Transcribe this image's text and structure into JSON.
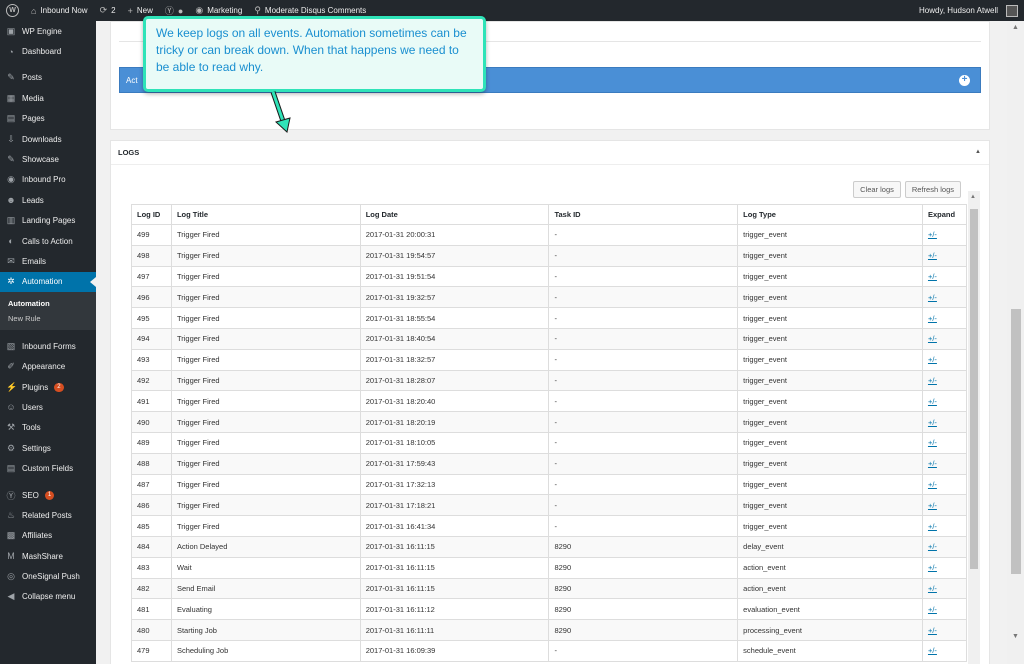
{
  "adminbar": {
    "site_name": "Inbound Now",
    "updates_count": "2",
    "new_label": "New",
    "marketing_label": "Marketing",
    "search_label": "Moderate Disqus Comments",
    "greeting": "Howdy, Hudson Atwell"
  },
  "sidebar": {
    "items": [
      {
        "label": "WP Engine",
        "icon": "wp-engine-icon",
        "glyph": "▣"
      },
      {
        "label": "Dashboard",
        "icon": "dashboard-icon",
        "glyph": "◔"
      },
      {
        "label": "Posts",
        "icon": "pin-icon",
        "glyph": "✎"
      },
      {
        "label": "Media",
        "icon": "media-icon",
        "glyph": "▦"
      },
      {
        "label": "Pages",
        "icon": "page-icon",
        "glyph": "▤"
      },
      {
        "label": "Downloads",
        "icon": "download-icon",
        "glyph": "⇩"
      },
      {
        "label": "Showcase",
        "icon": "pin-icon",
        "glyph": "✎"
      },
      {
        "label": "Inbound Pro",
        "icon": "inbound-icon",
        "glyph": "◉"
      },
      {
        "label": "Leads",
        "icon": "users-icon",
        "glyph": "☻"
      },
      {
        "label": "Landing Pages",
        "icon": "landing-icon",
        "glyph": "▥"
      },
      {
        "label": "Calls to Action",
        "icon": "cta-icon",
        "glyph": "◐"
      },
      {
        "label": "Emails",
        "icon": "mail-icon",
        "glyph": "✉"
      },
      {
        "label": "Automation",
        "icon": "gear-icon",
        "glyph": "✲"
      }
    ],
    "submenu": [
      "Automation",
      "New Rule"
    ],
    "items2": [
      {
        "label": "Inbound Forms",
        "icon": "form-icon",
        "glyph": "▧"
      },
      {
        "label": "Appearance",
        "icon": "brush-icon",
        "glyph": "✐"
      },
      {
        "label": "Plugins",
        "icon": "plugin-icon",
        "glyph": "⚡",
        "badge": "2"
      },
      {
        "label": "Users",
        "icon": "user-icon",
        "glyph": "☺"
      },
      {
        "label": "Tools",
        "icon": "wrench-icon",
        "glyph": "⚒"
      },
      {
        "label": "Settings",
        "icon": "settings-icon",
        "glyph": "⚙"
      },
      {
        "label": "Custom Fields",
        "icon": "fields-icon",
        "glyph": "▤"
      }
    ],
    "items3": [
      {
        "label": "SEO",
        "icon": "seo-icon",
        "glyph": "Ⓨ",
        "badge": "1"
      },
      {
        "label": "Related Posts",
        "icon": "flame-icon",
        "glyph": "♨"
      },
      {
        "label": "Affiliates",
        "icon": "affiliate-icon",
        "glyph": "▩"
      },
      {
        "label": "MashShare",
        "icon": "mash-icon",
        "glyph": "M"
      },
      {
        "label": "OneSignal Push",
        "icon": "push-icon",
        "glyph": "◎"
      },
      {
        "label": "Collapse menu",
        "icon": "collapse-icon",
        "glyph": "◀"
      }
    ]
  },
  "action_bar_label": "Act",
  "callout_text": "We keep logs on all events.  Automation sometimes can be tricky or can break down. When that happens we need to be able to read why.",
  "logs": {
    "title": "LOGS",
    "clear_label": "Clear logs",
    "refresh_label": "Refresh logs",
    "columns": [
      "Log ID",
      "Log Title",
      "Log Date",
      "Task ID",
      "Log Type",
      "Expand"
    ],
    "expand_label": "+/-",
    "rows": [
      [
        "499",
        "Trigger Fired",
        "2017-01-31 20:00:31",
        "-",
        "trigger_event"
      ],
      [
        "498",
        "Trigger Fired",
        "2017-01-31 19:54:57",
        "-",
        "trigger_event"
      ],
      [
        "497",
        "Trigger Fired",
        "2017-01-31 19:51:54",
        "-",
        "trigger_event"
      ],
      [
        "496",
        "Trigger Fired",
        "2017-01-31 19:32:57",
        "-",
        "trigger_event"
      ],
      [
        "495",
        "Trigger Fired",
        "2017-01-31 18:55:54",
        "-",
        "trigger_event"
      ],
      [
        "494",
        "Trigger Fired",
        "2017-01-31 18:40:54",
        "-",
        "trigger_event"
      ],
      [
        "493",
        "Trigger Fired",
        "2017-01-31 18:32:57",
        "-",
        "trigger_event"
      ],
      [
        "492",
        "Trigger Fired",
        "2017-01-31 18:28:07",
        "-",
        "trigger_event"
      ],
      [
        "491",
        "Trigger Fired",
        "2017-01-31 18:20:40",
        "-",
        "trigger_event"
      ],
      [
        "490",
        "Trigger Fired",
        "2017-01-31 18:20:19",
        "-",
        "trigger_event"
      ],
      [
        "489",
        "Trigger Fired",
        "2017-01-31 18:10:05",
        "-",
        "trigger_event"
      ],
      [
        "488",
        "Trigger Fired",
        "2017-01-31 17:59:43",
        "-",
        "trigger_event"
      ],
      [
        "487",
        "Trigger Fired",
        "2017-01-31 17:32:13",
        "-",
        "trigger_event"
      ],
      [
        "486",
        "Trigger Fired",
        "2017-01-31 17:18:21",
        "-",
        "trigger_event"
      ],
      [
        "485",
        "Trigger Fired",
        "2017-01-31 16:41:34",
        "-",
        "trigger_event"
      ],
      [
        "484",
        "Action Delayed",
        "2017-01-31 16:11:15",
        "8290",
        "delay_event"
      ],
      [
        "483",
        "Wait",
        "2017-01-31 16:11:15",
        "8290",
        "action_event"
      ],
      [
        "482",
        "Send Email",
        "2017-01-31 16:11:15",
        "8290",
        "action_event"
      ],
      [
        "481",
        "Evaluating",
        "2017-01-31 16:11:12",
        "8290",
        "evaluation_event"
      ],
      [
        "480",
        "Starting Job",
        "2017-01-31 16:11:11",
        "8290",
        "processing_event"
      ],
      [
        "479",
        "Scheduling Job",
        "2017-01-31 16:09:39",
        "-",
        "schedule_event"
      ]
    ]
  }
}
